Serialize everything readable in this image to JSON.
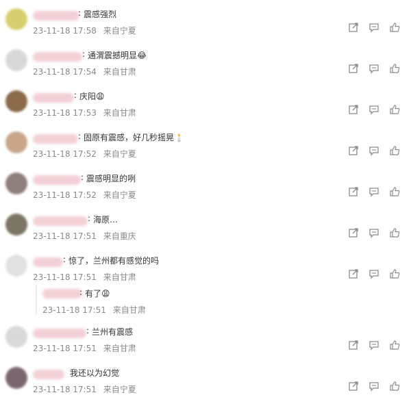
{
  "comments": [
    {
      "text": "震感强烈",
      "time": "23-11-18 17:58",
      "location": "来自宁夏"
    },
    {
      "text": "通渭震撼明显😂",
      "time": "23-11-18 17:54",
      "location": "来自甘肃"
    },
    {
      "text": "庆阳😩",
      "time": "23-11-18 17:53",
      "location": "来自甘肃"
    },
    {
      "text": "固原有震感，好几秒摇晃🕯️",
      "time": "23-11-18 17:52",
      "location": "来自宁夏"
    },
    {
      "text": "震感明显的咧",
      "time": "23-11-18 17:52",
      "location": "来自宁夏"
    },
    {
      "text": "海原…",
      "time": "23-11-18 17:51",
      "location": "来自重庆"
    },
    {
      "text": "惊了，兰州都有感觉的吗",
      "time": "23-11-18 17:51",
      "location": "来自甘肃"
    },
    {
      "text": "兰州有震感",
      "time": "23-11-18 17:51",
      "location": "来自甘肃"
    },
    {
      "text": "我还以为幻觉",
      "time": "23-11-18 17:51",
      "location": "来自宁夏"
    }
  ],
  "reply": {
    "text": "有了😩",
    "time": "23-11-18 17:51",
    "location": "来自甘肃"
  },
  "icons": {
    "share": "share-icon",
    "comment": "comment-icon",
    "like": "like-icon"
  }
}
